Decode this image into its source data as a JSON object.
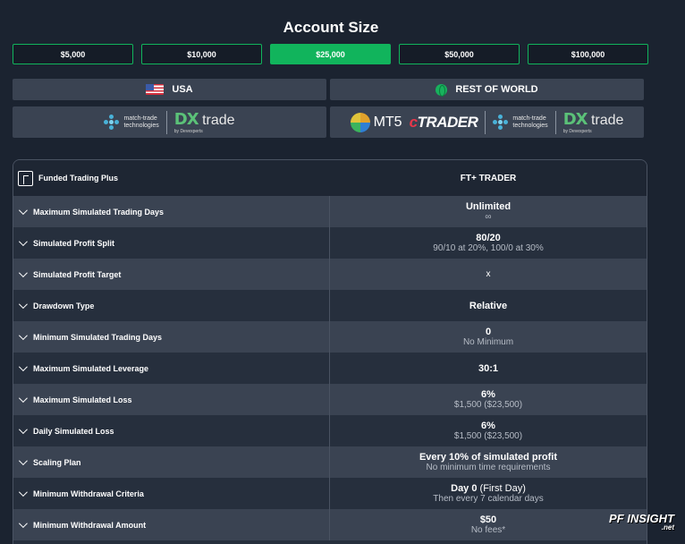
{
  "header": {
    "title": "Account Size"
  },
  "account_sizes": [
    {
      "label": "$5,000",
      "active": false
    },
    {
      "label": "$10,000",
      "active": false
    },
    {
      "label": "$25,000",
      "active": true
    },
    {
      "label": "$50,000",
      "active": false
    },
    {
      "label": "$100,000",
      "active": false
    }
  ],
  "regions": [
    {
      "label": "USA",
      "icon": "us-flag-icon"
    },
    {
      "label": "REST OF WORLD",
      "icon": "globe-icon"
    }
  ],
  "platforms": {
    "usa": {
      "matchtrade_line1": "match-trade",
      "matchtrade_line2": "technologies",
      "dx_mark": "DX",
      "dx_word": "trade",
      "dx_sub": "by Devexperts"
    },
    "row": {
      "mt5": "MT5",
      "ctrader_c": "c",
      "ctrader_rest": "TRADER",
      "matchtrade_line1": "match-trade",
      "matchtrade_line2": "technologies",
      "dx_mark": "DX",
      "dx_word": "trade",
      "dx_sub": "by Devexperts"
    }
  },
  "table": {
    "program_name": "Funded Trading Plus",
    "column_title": "FT+ TRADER",
    "rows": [
      {
        "label": "Maximum Simulated Trading Days",
        "main": "Unlimited",
        "sub": "∞"
      },
      {
        "label": "Simulated Profit Split",
        "main": "80/20",
        "sub": "90/10 at 20%, 100/0 at 30%"
      },
      {
        "label": "Simulated Profit Target",
        "main": "",
        "sub": "",
        "x": "x"
      },
      {
        "label": "Drawdown Type",
        "main": "Relative",
        "sub": ""
      },
      {
        "label": "Minimum Simulated Trading Days",
        "main": "0",
        "sub": "No Minimum"
      },
      {
        "label": "Maximum Simulated Leverage",
        "main": "30:1",
        "sub": ""
      },
      {
        "label": "Maximum Simulated Loss",
        "main": "6%",
        "sub": "$1,500 ($23,500)"
      },
      {
        "label": "Daily Simulated Loss",
        "main": "6%",
        "sub": "$1,500 ($23,500)"
      },
      {
        "label": "Scaling Plan",
        "main": "Every 10% of simulated profit",
        "sub": "No minimum time requirements"
      },
      {
        "label": "Minimum Withdrawal Criteria",
        "main": "Day 0",
        "main_light": " (First Day)",
        "sub": "Then every 7 calendar days"
      },
      {
        "label": "Minimum Withdrawal Amount",
        "main": "$50",
        "sub": "No fees*"
      }
    ]
  },
  "watermark": {
    "line1": "PF INSIGHT",
    "line2": ".net"
  },
  "colors": {
    "accent_green": "#11b45c",
    "background": "#1b2330",
    "row_dark": "#262f3d",
    "row_light": "#3a4352"
  }
}
